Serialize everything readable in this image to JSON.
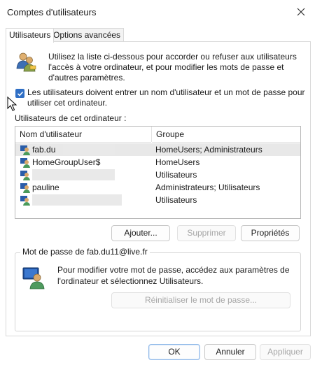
{
  "window": {
    "title": "Comptes d'utilisateurs"
  },
  "tabs": [
    {
      "label": "Utilisateurs",
      "active": true
    },
    {
      "label": "Options avancées",
      "active": false
    }
  ],
  "intro": {
    "text": "Utilisez la liste ci-dessous pour accorder ou refuser aux utilisateurs l'accès à votre ordinateur, et pour modifier les mots de passe et d'autres paramètres."
  },
  "require_password": {
    "checked": true,
    "label": "Les utilisateurs doivent entrer un nom d'utilisateur et un mot de passe pour utiliser cet ordinateur."
  },
  "users_list": {
    "label": "Utilisateurs de cet ordinateur :",
    "columns": [
      "Nom d'utilisateur",
      "Groupe"
    ],
    "rows": [
      {
        "name": "fab.du",
        "group": "HomeUsers; Administrateurs",
        "selected": true
      },
      {
        "name": "HomeGroupUser$",
        "group": "HomeUsers",
        "selected": false
      },
      {
        "name": "",
        "group": "Utilisateurs",
        "selected": false
      },
      {
        "name": "pauline",
        "group": "Administrateurs; Utilisateurs",
        "selected": false
      },
      {
        "name": "",
        "group": "Utilisateurs",
        "selected": false
      }
    ]
  },
  "list_buttons": {
    "add": "Ajouter...",
    "remove": "Supprimer",
    "properties": "Propriétés"
  },
  "password_group": {
    "label": "Mot de passe de fab.du11@live.fr",
    "text": "Pour modifier votre mot de passe, accédez aux paramètres de l'ordinateur et sélectionnez Utilisateurs.",
    "reset_button": "Réinitialiser le mot de passe..."
  },
  "footer": {
    "ok": "OK",
    "cancel": "Annuler",
    "apply": "Appliquer"
  },
  "colors": {
    "accent": "#2f6fc5",
    "selection": "#e8e8e8"
  }
}
